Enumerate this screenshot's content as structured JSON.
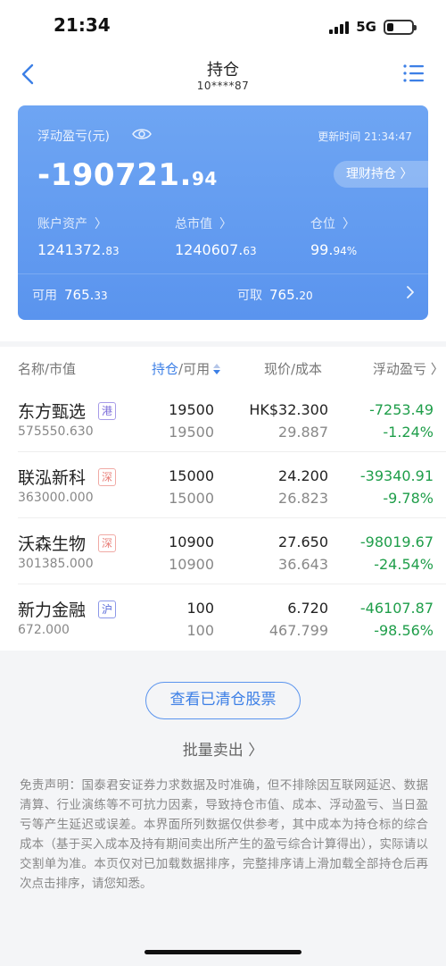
{
  "status": {
    "time": "21:34",
    "network": "5G"
  },
  "nav": {
    "title": "持仓",
    "account": "10****87"
  },
  "card": {
    "floating_pl_label": "浮动盈亏(元)",
    "update_time": "更新时间 21:34:47",
    "floating_pl_int": "-190721.",
    "floating_pl_dec": "94",
    "finance_button": "理财持仓 〉",
    "account_assets_label": "账户资产",
    "account_assets_int": "1241372.",
    "account_assets_dec": "83",
    "total_mv_label": "总市值",
    "total_mv_int": "1240607.",
    "total_mv_dec": "63",
    "position_label": "仓位",
    "position_int": "99.",
    "position_dec": "94%",
    "available_label": "可用",
    "available_int": "765.",
    "available_dec": "33",
    "withdrawable_label": "可取",
    "withdrawable_int": "765.",
    "withdrawable_dec": "20"
  },
  "table": {
    "headers": {
      "name": "名称/市值",
      "position_a": "持仓",
      "position_b": "/可用",
      "price": "现价/成本",
      "pl": "浮动盈亏"
    },
    "rows": [
      {
        "name": "东方甄选",
        "market": "港",
        "market_value": "575550.630",
        "holding": "19500",
        "available": "19500",
        "price": "HK$32.300",
        "cost": "29.887",
        "pl": "-7253.49",
        "pl_pct": "-1.24%"
      },
      {
        "name": "联泓新科",
        "market": "深",
        "market_value": "363000.000",
        "holding": "15000",
        "available": "15000",
        "price": "24.200",
        "cost": "26.823",
        "pl": "-39340.91",
        "pl_pct": "-9.78%"
      },
      {
        "name": "沃森生物",
        "market": "深",
        "market_value": "301385.000",
        "holding": "10900",
        "available": "10900",
        "price": "27.650",
        "cost": "36.643",
        "pl": "-98019.67",
        "pl_pct": "-24.54%"
      },
      {
        "name": "新力金融",
        "market": "沪",
        "market_value": "672.000",
        "holding": "100",
        "available": "100",
        "price": "6.720",
        "cost": "467.799",
        "pl": "-46107.87",
        "pl_pct": "-98.56%"
      }
    ]
  },
  "actions": {
    "cleared_stocks": "查看已清仓股票",
    "batch_sell": "批量卖出 〉"
  },
  "disclaimer": "免责声明：国泰君安证券力求数据及时准确，但不排除因互联网延迟、数据清算、行业演练等不可抗力因素，导致持仓市值、成本、浮动盈亏、当日盈亏等产生延迟或误差。本界面所列数据仅供参考，其中成本为持仓标的综合成本（基于买入成本及持有期间卖出所产生的盈亏综合计算得出），实际请以交割单为准。本页仅对已加载数据排序，完整排序请上滑加载全部持仓后再次点击排序，请您知悉。",
  "colors": {
    "accent": "#5a94ee",
    "loss": "#1f9e4a"
  }
}
